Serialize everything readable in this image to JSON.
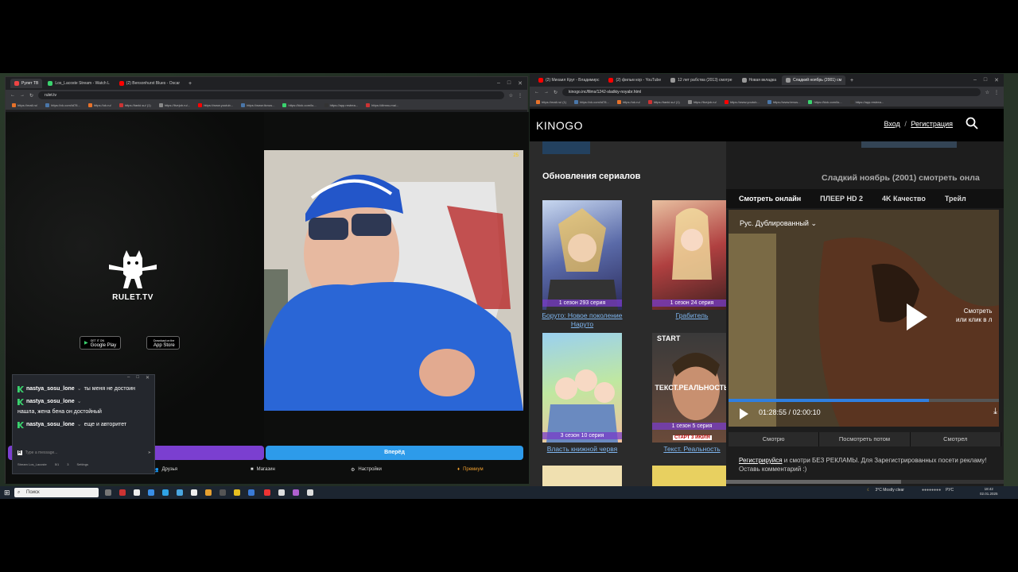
{
  "left_browser": {
    "tabs": [
      {
        "label": "Рулет ТВ",
        "color": "#e44"
      },
      {
        "label": "Los_Lacoste Stream - Watch L",
        "color": "#3ad36e"
      },
      {
        "label": "(2) Bensonhurst Blues - Oscar",
        "color": "#f00"
      }
    ],
    "url": "rulet.tv",
    "bookmarks": [
      "https://mail.ru/",
      "https://vk.com/id78...",
      "https://ok.ru/",
      "https://tanki.su/ (1)",
      "https://livejob.ru/...",
      "https://www.youtub...",
      "https://www.ticnus...",
      "https://kick.com/lo...",
      "https://app.restrea...",
      "https://dtmnu.ma/..."
    ]
  },
  "rulet": {
    "logo_text": "RULET.TV",
    "google_play_small": "GET IT ON",
    "google_play": "Google Play",
    "app_store_small": "Download on the",
    "app_store": "App Store",
    "viewer_count": "25",
    "start_button": "Вперёд",
    "nav": {
      "friends": "Друзья",
      "shop": "Магазин",
      "settings": "Настройки",
      "premium": "Премиум"
    }
  },
  "chat": {
    "messages": [
      {
        "user": "nastya_sosu_lone",
        "text": "ты меня не достоин"
      },
      {
        "user": "nastya_sosu_lone",
        "text": "нашла, жена бена он достойный"
      },
      {
        "user": "nastya_sosu_lone",
        "text": "еще и авторитет"
      }
    ],
    "input_placeholder": "Type a message...",
    "footer_stream": "Stream Los_Lacoste",
    "footer_count": "5/1",
    "footer_viewers": "3",
    "footer_settings": "Settings"
  },
  "right_browser": {
    "tabs": [
      {
        "label": "(2) Михаил Круг - Владимирс",
        "color": "#f00"
      },
      {
        "label": "(2) фильм кор - YouTube",
        "color": "#f00"
      },
      {
        "label": "12 лет рабства (2013) смотре",
        "color": "#999"
      },
      {
        "label": "Новая вкладка",
        "color": "#999"
      },
      {
        "label": "Сладкий ноябрь (2001) см",
        "color": "#999"
      }
    ],
    "url": "kinogo.inc/films/1242-sladkiy-noyabr.html",
    "bookmarks": [
      "https://mail.ru/ (1)",
      "https://vk.com/id78...",
      "https://ok.ru/",
      "https://tanki.su/ (1)",
      "https://livejob.ru/",
      "https://www.youtub...",
      "https://www.tenus...",
      "https://kick.com/lo...",
      "https://app.restrea..."
    ]
  },
  "kinogo": {
    "logo": "KINOGO",
    "login": "Вход",
    "separator": "/",
    "register": "Регистрация",
    "sidebar_title": "Обновления сериалов",
    "series": [
      {
        "episode": "1 сезон 293 серия",
        "title": "Боруто: Новое поколение Наруто"
      },
      {
        "episode": "1 сезон 24 серия",
        "title": "Грабитель"
      },
      {
        "episode": "3 сезон 10 серия",
        "title": "Власть книжной червя"
      },
      {
        "episode": "1 сезон 5 серия",
        "title": "Текст. Реальность",
        "badge": "СТАРТ 3 ИЮЛЯ",
        "poster_text": "ТЕКСТ.РЕАЛЬНОСТЬ",
        "poster_top": "START"
      }
    ],
    "movie_title": "Сладкий ноябрь (2001) смотреть онла",
    "tabs": [
      "Смотреть онлайн",
      "ПЛЕЕР HD 2",
      "4K Качество",
      "Трейл"
    ],
    "dub": "Рус. Дублированный",
    "overlay_text_1": "Смотреть",
    "overlay_text_2": "или клик в л",
    "time_current": "01:28:55",
    "time_total": "02:00:10",
    "progress": 0.74,
    "actions": [
      "Смотрю",
      "Посмотреть потом",
      "Смотрел"
    ],
    "promo_link": "Регистрируйся",
    "promo_text": " и смотри БЕЗ РЕКЛАМЫ. Для Зарегистрированных посети рекламу! Оставь комментарий :)"
  },
  "taskbar": {
    "search": "Поиск",
    "weather": "3°C  Mostly clear",
    "lang": "РУС",
    "time": "18:42",
    "date": "02.01.2025"
  }
}
